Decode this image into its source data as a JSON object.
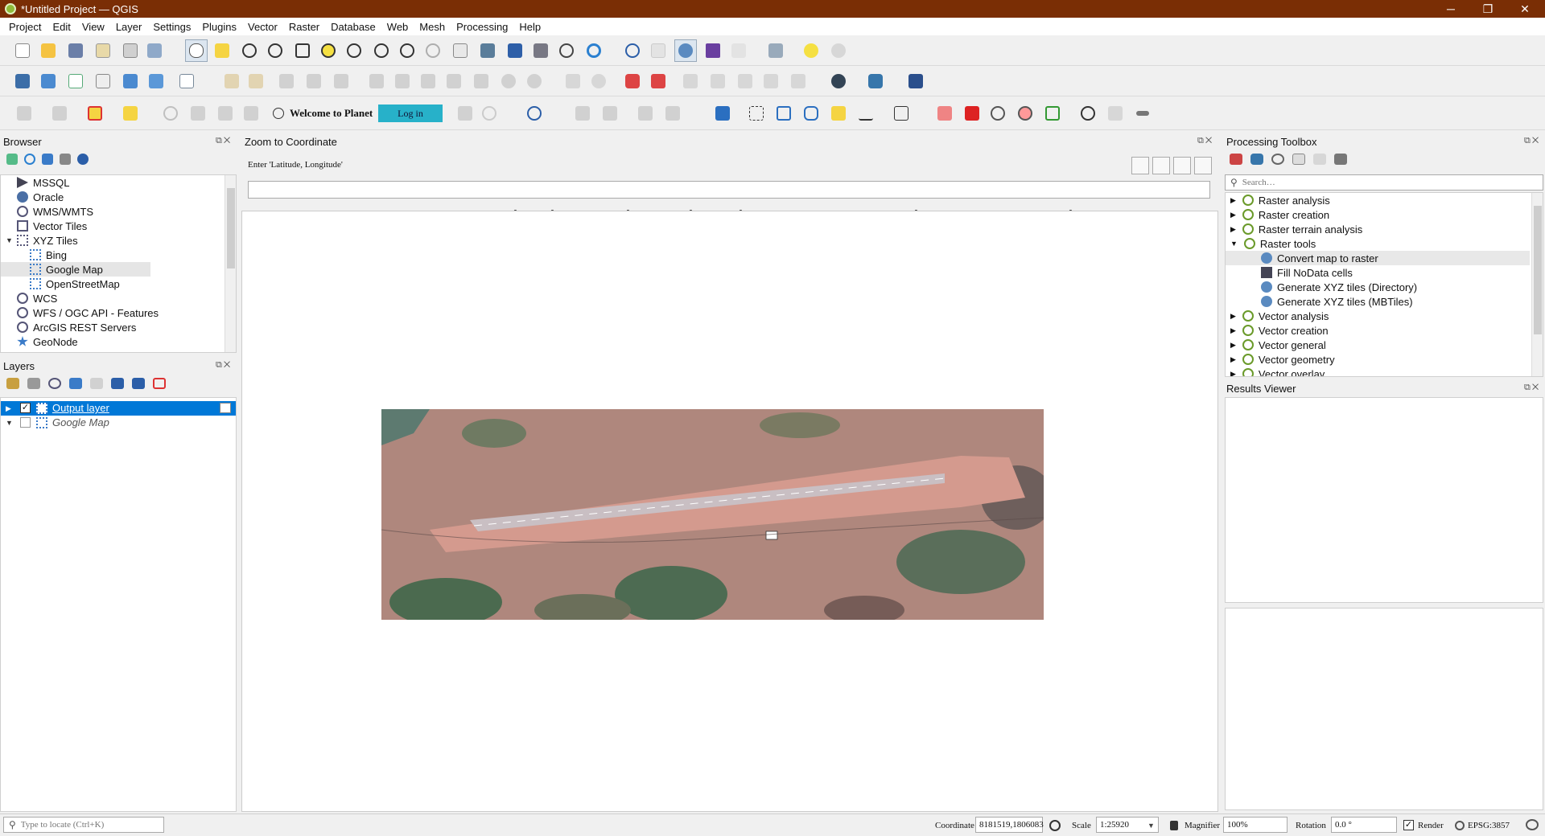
{
  "window": {
    "title": "*Untitled Project — QGIS",
    "minimize_glyph": "─",
    "restore_glyph": "❐",
    "close_glyph": "✕"
  },
  "menu": [
    "Project",
    "Edit",
    "View",
    "Layer",
    "Settings",
    "Plugins",
    "Vector",
    "Raster",
    "Database",
    "Web",
    "Mesh",
    "Processing",
    "Help"
  ],
  "planet": {
    "welcome": "Welcome to Planet",
    "login": "Log in"
  },
  "browser": {
    "title": "Browser",
    "items": [
      {
        "label": "MSSQL",
        "icon": "mssql-icon"
      },
      {
        "label": "Oracle",
        "icon": "oracle-icon"
      },
      {
        "label": "WMS/WMTS",
        "icon": "wms-icon"
      },
      {
        "label": "Vector Tiles",
        "icon": "vector-tiles-icon"
      },
      {
        "label": "XYZ Tiles",
        "icon": "xyz-tiles-icon"
      },
      {
        "label": "Bing",
        "icon": "xyz-tile-icon"
      },
      {
        "label": "Google Map",
        "icon": "xyz-tile-icon"
      },
      {
        "label": "OpenStreetMap",
        "icon": "xyz-tile-icon"
      },
      {
        "label": "WCS",
        "icon": "wcs-icon"
      },
      {
        "label": "WFS / OGC API - Features",
        "icon": "wfs-icon"
      },
      {
        "label": "ArcGIS REST Servers",
        "icon": "arcgis-icon"
      },
      {
        "label": "GeoNode",
        "icon": "geonode-icon"
      }
    ]
  },
  "layers": {
    "title": "Layers",
    "items": [
      {
        "label": "Output layer",
        "checked": true,
        "selected": true
      },
      {
        "label": "Google Map",
        "checked": false,
        "selected": false
      }
    ]
  },
  "zoom_panel": {
    "title": "Zoom to Coordinate",
    "prompt": "Enter 'Latitude, Longitude'",
    "input_value": ""
  },
  "processing": {
    "title": "Processing Toolbox",
    "search_placeholder": "Search…",
    "items": [
      {
        "label": "Raster analysis",
        "expanded": false
      },
      {
        "label": "Raster creation",
        "expanded": false
      },
      {
        "label": "Raster terrain analysis",
        "expanded": false
      },
      {
        "label": "Raster tools",
        "expanded": true
      },
      {
        "label": "Convert map to raster",
        "child": true,
        "highlight": true
      },
      {
        "label": "Fill NoData cells",
        "child": true
      },
      {
        "label": "Generate XYZ tiles (Directory)",
        "child": true
      },
      {
        "label": "Generate XYZ tiles (MBTiles)",
        "child": true
      },
      {
        "label": "Vector analysis",
        "expanded": false
      },
      {
        "label": "Vector creation",
        "expanded": false
      },
      {
        "label": "Vector general",
        "expanded": false
      },
      {
        "label": "Vector geometry",
        "expanded": false
      },
      {
        "label": "Vector overlay",
        "expanded": false
      }
    ]
  },
  "results_viewer": {
    "title": "Results Viewer"
  },
  "status": {
    "locate_placeholder": "Type to locate (Ctrl+K)",
    "coordinate_label": "Coordinate",
    "coordinate_value": "8181519,1806083",
    "scale_label": "Scale",
    "scale_value": "1:25920",
    "magnifier_label": "Magnifier",
    "magnifier_value": "100%",
    "rotation_label": "Rotation",
    "rotation_value": "0.0 °",
    "render_label": "Render",
    "crs": "EPSG:3857"
  },
  "colors": {
    "title_bar": "#7a2e05",
    "selection": "#0078d7",
    "login_button": "#27b1c9"
  }
}
